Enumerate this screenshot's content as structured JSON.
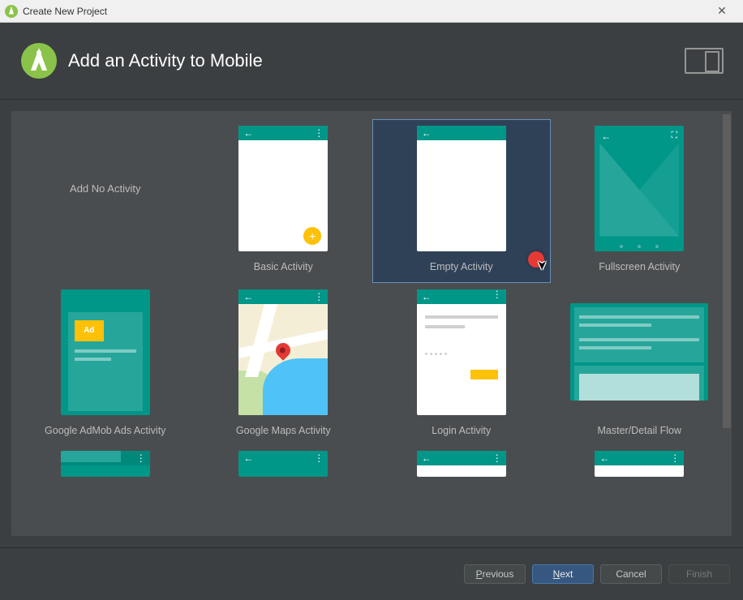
{
  "window": {
    "title": "Create New Project",
    "close_glyph": "✕"
  },
  "header": {
    "title": "Add an Activity to Mobile"
  },
  "activities": [
    {
      "id": "add-none",
      "label": "Add No Activity",
      "selected": false
    },
    {
      "id": "basic",
      "label": "Basic Activity",
      "selected": false
    },
    {
      "id": "empty",
      "label": "Empty Activity",
      "selected": true
    },
    {
      "id": "fullscreen",
      "label": "Fullscreen Activity",
      "selected": false
    },
    {
      "id": "admob",
      "label": "Google AdMob Ads Activity",
      "selected": false
    },
    {
      "id": "maps",
      "label": "Google Maps Activity",
      "selected": false
    },
    {
      "id": "login",
      "label": "Login Activity",
      "selected": false
    },
    {
      "id": "master-detail",
      "label": "Master/Detail Flow",
      "selected": false
    }
  ],
  "icons": {
    "back_arrow": "←",
    "more_dots": "⋮",
    "plus": "+",
    "expand": "⛶",
    "cursor": "➤"
  },
  "thumbs": {
    "admob_label": "Ad"
  },
  "buttons": {
    "previous": "Previous",
    "next": "Next",
    "cancel": "Cancel",
    "finish": "Finish"
  }
}
